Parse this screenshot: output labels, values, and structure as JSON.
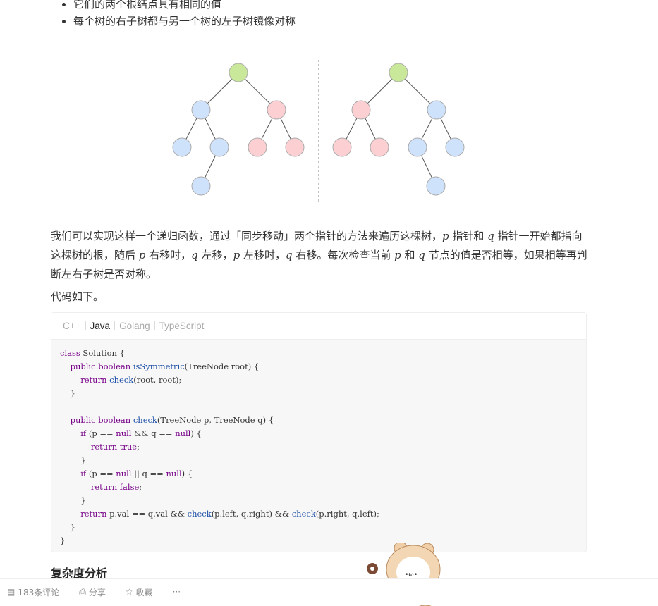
{
  "bullets": [
    "它们的两个根结点具有相同的值",
    "每个树的右子树都与另一个树的左子树镜像对称"
  ],
  "diagram": {
    "colors": {
      "root": "#c9e89a",
      "blue": "#cfe2fb",
      "pink": "#fccfd3"
    },
    "left_tree": {
      "root": "root",
      "level1": [
        "blue",
        "pink"
      ],
      "level2": [
        "blue",
        "blue",
        "pink",
        "pink"
      ],
      "level3": [
        "blue"
      ]
    },
    "right_tree": {
      "root": "root",
      "level1": [
        "pink",
        "blue"
      ],
      "level2": [
        "pink",
        "pink",
        "blue",
        "blue"
      ],
      "level3": [
        "blue"
      ]
    }
  },
  "paragraph1": [
    {
      "t": "我们可以实现这样一个递归函数，通过「同步移动」两个指针的方法来遍历这棵树，"
    },
    {
      "m": "p"
    },
    {
      "t": " 指针和 "
    },
    {
      "m": "q"
    },
    {
      "t": " 指针一开始都指向这棵树的根，随后 "
    },
    {
      "m": "p"
    },
    {
      "t": " 右移时，"
    },
    {
      "m": "q"
    },
    {
      "t": " 左移，"
    },
    {
      "m": "p"
    },
    {
      "t": " 左移时，"
    },
    {
      "m": "q"
    },
    {
      "t": " 右移。每次检查当前 "
    },
    {
      "m": "p"
    },
    {
      "t": " 和 "
    },
    {
      "m": "q"
    },
    {
      "t": " 节点的值是否相等，如果相等再判断左右子树是否对称。"
    }
  ],
  "paragraph2": "代码如下。",
  "code": {
    "tabs": [
      "C++",
      "Java",
      "Golang",
      "TypeScript"
    ],
    "active_tab": "Java",
    "lines": [
      "class Solution {",
      "    public boolean isSymmetric(TreeNode root) {",
      "        return check(root, root);",
      "    }",
      "",
      "    public boolean check(TreeNode p, TreeNode q) {",
      "        if (p == null && q == null) {",
      "            return true;",
      "        }",
      "        if (p == null || q == null) {",
      "            return false;",
      "        }",
      "        return p.val == q.val && check(p.left, q.right) && check(p.right, q.left);",
      "    }",
      "}"
    ]
  },
  "heading": "复杂度分析",
  "footer": {
    "comments": "183条评论",
    "share": "分享",
    "favorite": "收藏",
    "more": "···"
  }
}
